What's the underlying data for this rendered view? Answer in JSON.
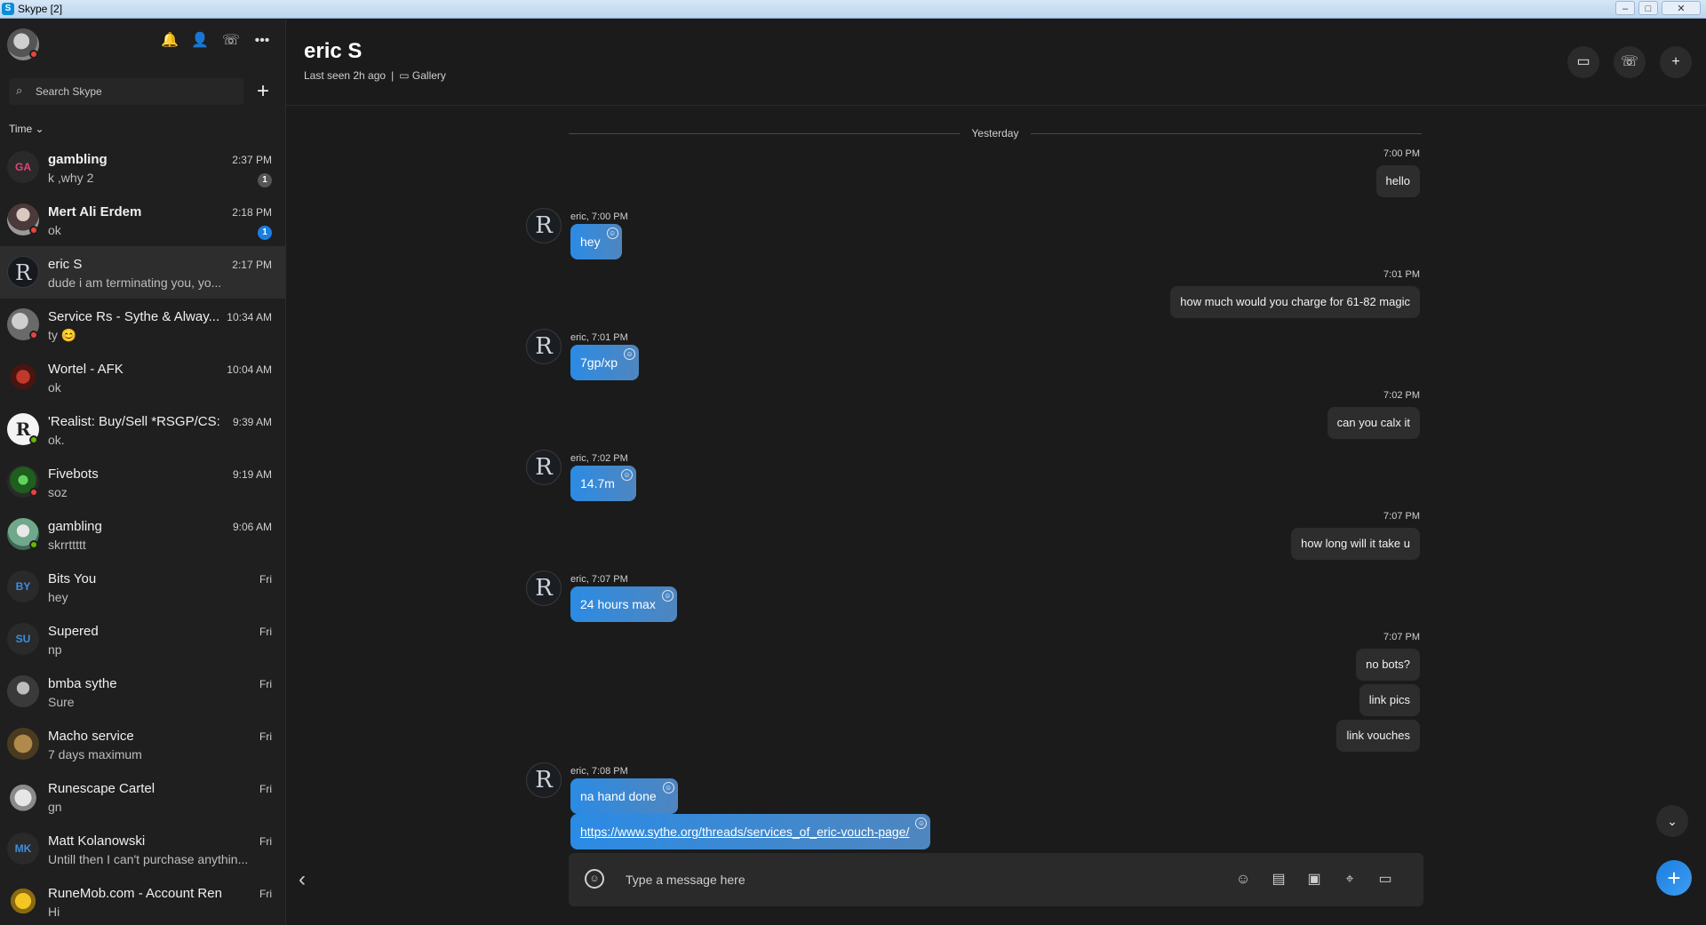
{
  "window": {
    "title": "Skype [2]",
    "minimize": "–",
    "maximize": "□",
    "close": "✕",
    "app_icon": "S"
  },
  "sidebar": {
    "icons": {
      "notifications": "🔔",
      "contacts": "👤",
      "calls": "☏",
      "more": "•••"
    },
    "search_placeholder": "Search Skype",
    "search_icon": "⌕",
    "new_chat": "+",
    "sort_label": "Time ⌄",
    "contacts": [
      {
        "name": "gambling",
        "message": "k ,why 2",
        "time": "2:37 PM",
        "initials": "GA",
        "badge": "1",
        "bold": true
      },
      {
        "name": "Mert Ali Erdem",
        "message": "ok",
        "time": "2:18 PM",
        "initials": "",
        "badge": "1",
        "bold": true
      },
      {
        "name": "eric S",
        "message": "dude i am terminating you, yo...",
        "time": "2:17 PM",
        "initials": "R"
      },
      {
        "name": "Service Rs - Sythe & Alway...",
        "message": "ty 😊",
        "time": "10:34 AM",
        "initials": ""
      },
      {
        "name": "Wortel - AFK",
        "message": "ok",
        "time": "10:04 AM",
        "initials": ""
      },
      {
        "name": "'Realist: Buy/Sell *RSGP/CS:...",
        "message": "ok.",
        "time": "9:39 AM",
        "initials": ""
      },
      {
        "name": "Fivebots",
        "message": "soz",
        "time": "9:19 AM",
        "initials": ""
      },
      {
        "name": "gambling",
        "message": "skrrttttt",
        "time": "9:06 AM",
        "initials": ""
      },
      {
        "name": "Bits You",
        "message": "hey",
        "time": "Fri",
        "initials": "BY"
      },
      {
        "name": "Supered",
        "message": "np",
        "time": "Fri",
        "initials": "SU"
      },
      {
        "name": "bmba sythe",
        "message": "Sure",
        "time": "Fri",
        "initials": ""
      },
      {
        "name": "Macho service",
        "message": "7 days maximum",
        "time": "Fri",
        "initials": ""
      },
      {
        "name": "Runescape Cartel",
        "message": "gn",
        "time": "Fri",
        "initials": ""
      },
      {
        "name": "Matt Kolanowski",
        "message": "Untill then I can't purchase anythin...",
        "time": "Fri",
        "initials": "MK"
      },
      {
        "name": "RuneMob.com - Account Rentals...",
        "message": "Hi",
        "time": "Fri",
        "initials": ""
      }
    ]
  },
  "chat": {
    "name": "eric S",
    "last_seen": "Last seen 2h ago",
    "separator": "|",
    "gallery_icon": "▭",
    "gallery": "Gallery",
    "header_icons": {
      "video": "▭",
      "call": "☏",
      "add_person": "+"
    },
    "day_divider": "Yesterday",
    "avatar_letter": "R",
    "reaction_icon": "☺",
    "messages": {
      "out1_time": "7:00 PM",
      "out1_text": "hello",
      "in1_meta": "eric, 7:00 PM",
      "in1_text": "hey",
      "out2_time": "7:01 PM",
      "out2_text": "how much would you charge for 61-82 magic",
      "in2_meta": "eric, 7:01 PM",
      "in2_text": "7gp/xp",
      "out3_time": "7:02 PM",
      "out3_text": "can you calx it",
      "in3_meta": "eric, 7:02 PM",
      "in3_text": "14.7m",
      "out4_time": "7:07 PM",
      "out4_text": "how long will it take u",
      "in4_meta": "eric, 7:07 PM",
      "in4_text": "24 hours max",
      "out5_time": "7:07 PM",
      "out5_text1": "no bots?",
      "out5_text2": "link pics",
      "out5_text3": "link vouches",
      "in5_meta": "eric, 7:08 PM",
      "in5_text1": "na hand done",
      "in5_text2": "https://www.sythe.org/threads/services_of_eric-vouch-page/"
    },
    "composer_placeholder": "Type a message here",
    "composer_icons": {
      "emoji": "☺",
      "sticker": "☺",
      "file": "▤",
      "money": "▣",
      "location": "⌖",
      "video_msg": "▭"
    },
    "back_icon": "‹",
    "scroll_down_icon": "⌄",
    "fab_icon": "+"
  },
  "colors": {
    "accent": "#2b8be4",
    "sidebar_bg": "#1f1f1f",
    "main_bg": "#1b1b1b",
    "status_red": "#e8453c",
    "status_green": "#6bb700"
  }
}
